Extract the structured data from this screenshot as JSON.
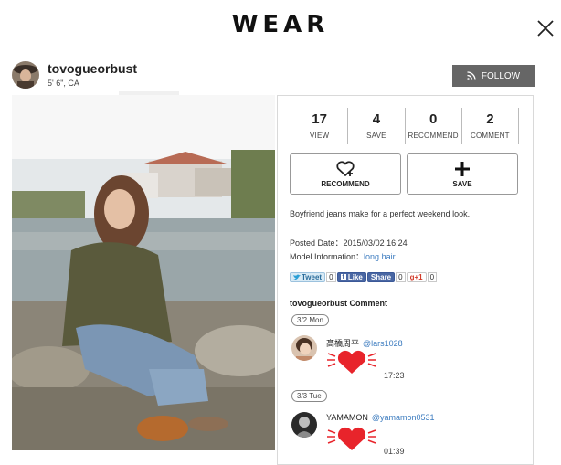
{
  "header": {
    "logo": "WEAR",
    "close_icon": "close-icon"
  },
  "user": {
    "name": "tovogueorbust",
    "info": "5' 6\", CA",
    "follow_label": "FOLLOW",
    "follow_icon": "rss-icon"
  },
  "stats": [
    {
      "value": "17",
      "label": "VIEW"
    },
    {
      "value": "4",
      "label": "SAVE"
    },
    {
      "value": "0",
      "label": "RECOMMEND"
    },
    {
      "value": "2",
      "label": "COMMENT"
    }
  ],
  "actions": {
    "recommend_label": "RECOMMEND",
    "save_label": "SAVE"
  },
  "description": "Boyfriend jeans make for a perfect weekend look.",
  "posted": {
    "label": "Posted Date：",
    "value": "2015/03/02 16:24"
  },
  "model": {
    "label": "Model Information：",
    "value": "long hair"
  },
  "social": {
    "tweet_label": "Tweet",
    "tweet_count": "0",
    "like_label": "Like",
    "share_label": "Share",
    "fb_count": "0",
    "gplus_label": "g+1",
    "gplus_count": "0"
  },
  "comments": {
    "title": "tovogueorbust Comment",
    "items": [
      {
        "date": "3/2 Mon",
        "name": "髙橋周平",
        "handle": "@lars1028",
        "time": "17:23"
      },
      {
        "date": "3/3 Tue",
        "name": "YAMAMON",
        "handle": "@yamamon0531",
        "time": "01:39"
      }
    ]
  },
  "colors": {
    "follow_bg": "#666666",
    "link": "#3b7bbf",
    "heart": "#e8242b"
  }
}
